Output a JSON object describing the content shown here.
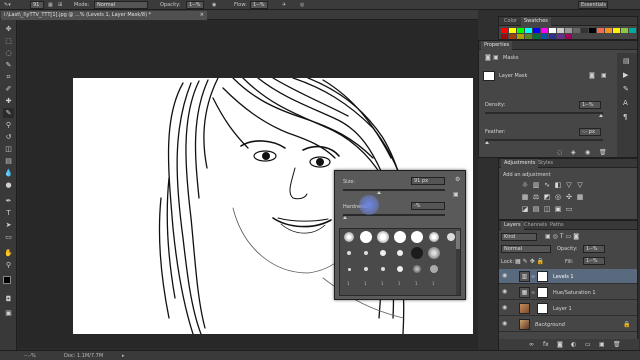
{
  "options_bar": {
    "brush_size": "91",
    "mode_label": "Mode:",
    "mode_value": "Normal",
    "opacity_label": "Opacity:",
    "opacity_value": "1--%",
    "flow_label": "Flow:",
    "flow_value": "1--%",
    "workspace": "Essentials"
  },
  "document_tab": {
    "title": "i:\\Last\\_I\\yTTV_TTT[1].jpg @ ...% (Levels 1, Layer Mask/8) *",
    "close": "×"
  },
  "status_bar": {
    "zoom": "--.-%",
    "doc_info": "Doc: 1.1M/7.7M"
  },
  "colors": {
    "accent": "#3d77b9",
    "foreground_color": "#000000",
    "background_color": "#ffffff",
    "panel_bg": "#464646",
    "canvas_bg": "#ffffff"
  },
  "swatches_panel": {
    "tabs": [
      "Color",
      "Swatches"
    ],
    "active_tab": "Swatches"
  },
  "properties_panel": {
    "title": "Properties",
    "section": "Masks",
    "mask_label": "Layer Mask",
    "density_label": "Density:",
    "density_value": "1--%",
    "feather_label": "Feather:",
    "feather_value": "-.- px"
  },
  "adjustments_panel": {
    "tabs": [
      "Adjustments",
      "Styles"
    ],
    "active_tab": "Adjustments",
    "heading": "Add an adjustment"
  },
  "layers_panel": {
    "tabs": [
      "Layers",
      "Channels",
      "Paths"
    ],
    "active_tab": "Layers",
    "filter_label": "Kind",
    "blend_mode": "Normal",
    "opacity_label": "Opacity:",
    "opacity_value": "1--%",
    "lock_label": "Lock:",
    "fill_label": "Fill:",
    "fill_value": "1--%",
    "layers": [
      {
        "name": "Levels 1",
        "selected": true,
        "type": "adjustment"
      },
      {
        "name": "Hue/Saturation 1",
        "selected": false,
        "type": "adjustment"
      },
      {
        "name": "Layer 1",
        "selected": false,
        "type": "pixel"
      },
      {
        "name": "Background",
        "selected": false,
        "type": "background",
        "italic": true
      }
    ]
  },
  "brush_popup": {
    "size_label": "Size:",
    "size_value": "91 px",
    "hardness_label": "Hardness:",
    "hardness_value": "-%",
    "preset_sizes": [
      "1",
      "1",
      "1",
      "1",
      "1",
      "1",
      "1",
      "1",
      "1",
      "1"
    ]
  },
  "toolbar": {
    "tools": [
      "move-tool-icon",
      "marquee-tool-icon",
      "lasso-tool-icon",
      "quick-select-tool-icon",
      "crop-tool-icon",
      "eyedropper-tool-icon",
      "healing-brush-tool-icon",
      "brush-tool-icon",
      "clone-stamp-tool-icon",
      "history-brush-tool-icon",
      "eraser-tool-icon",
      "gradient-tool-icon",
      "blur-tool-icon",
      "dodge-tool-icon",
      "pen-tool-icon",
      "type-tool-icon",
      "path-select-tool-icon",
      "shape-tool-icon",
      "hand-tool-icon",
      "zoom-tool-icon"
    ]
  }
}
